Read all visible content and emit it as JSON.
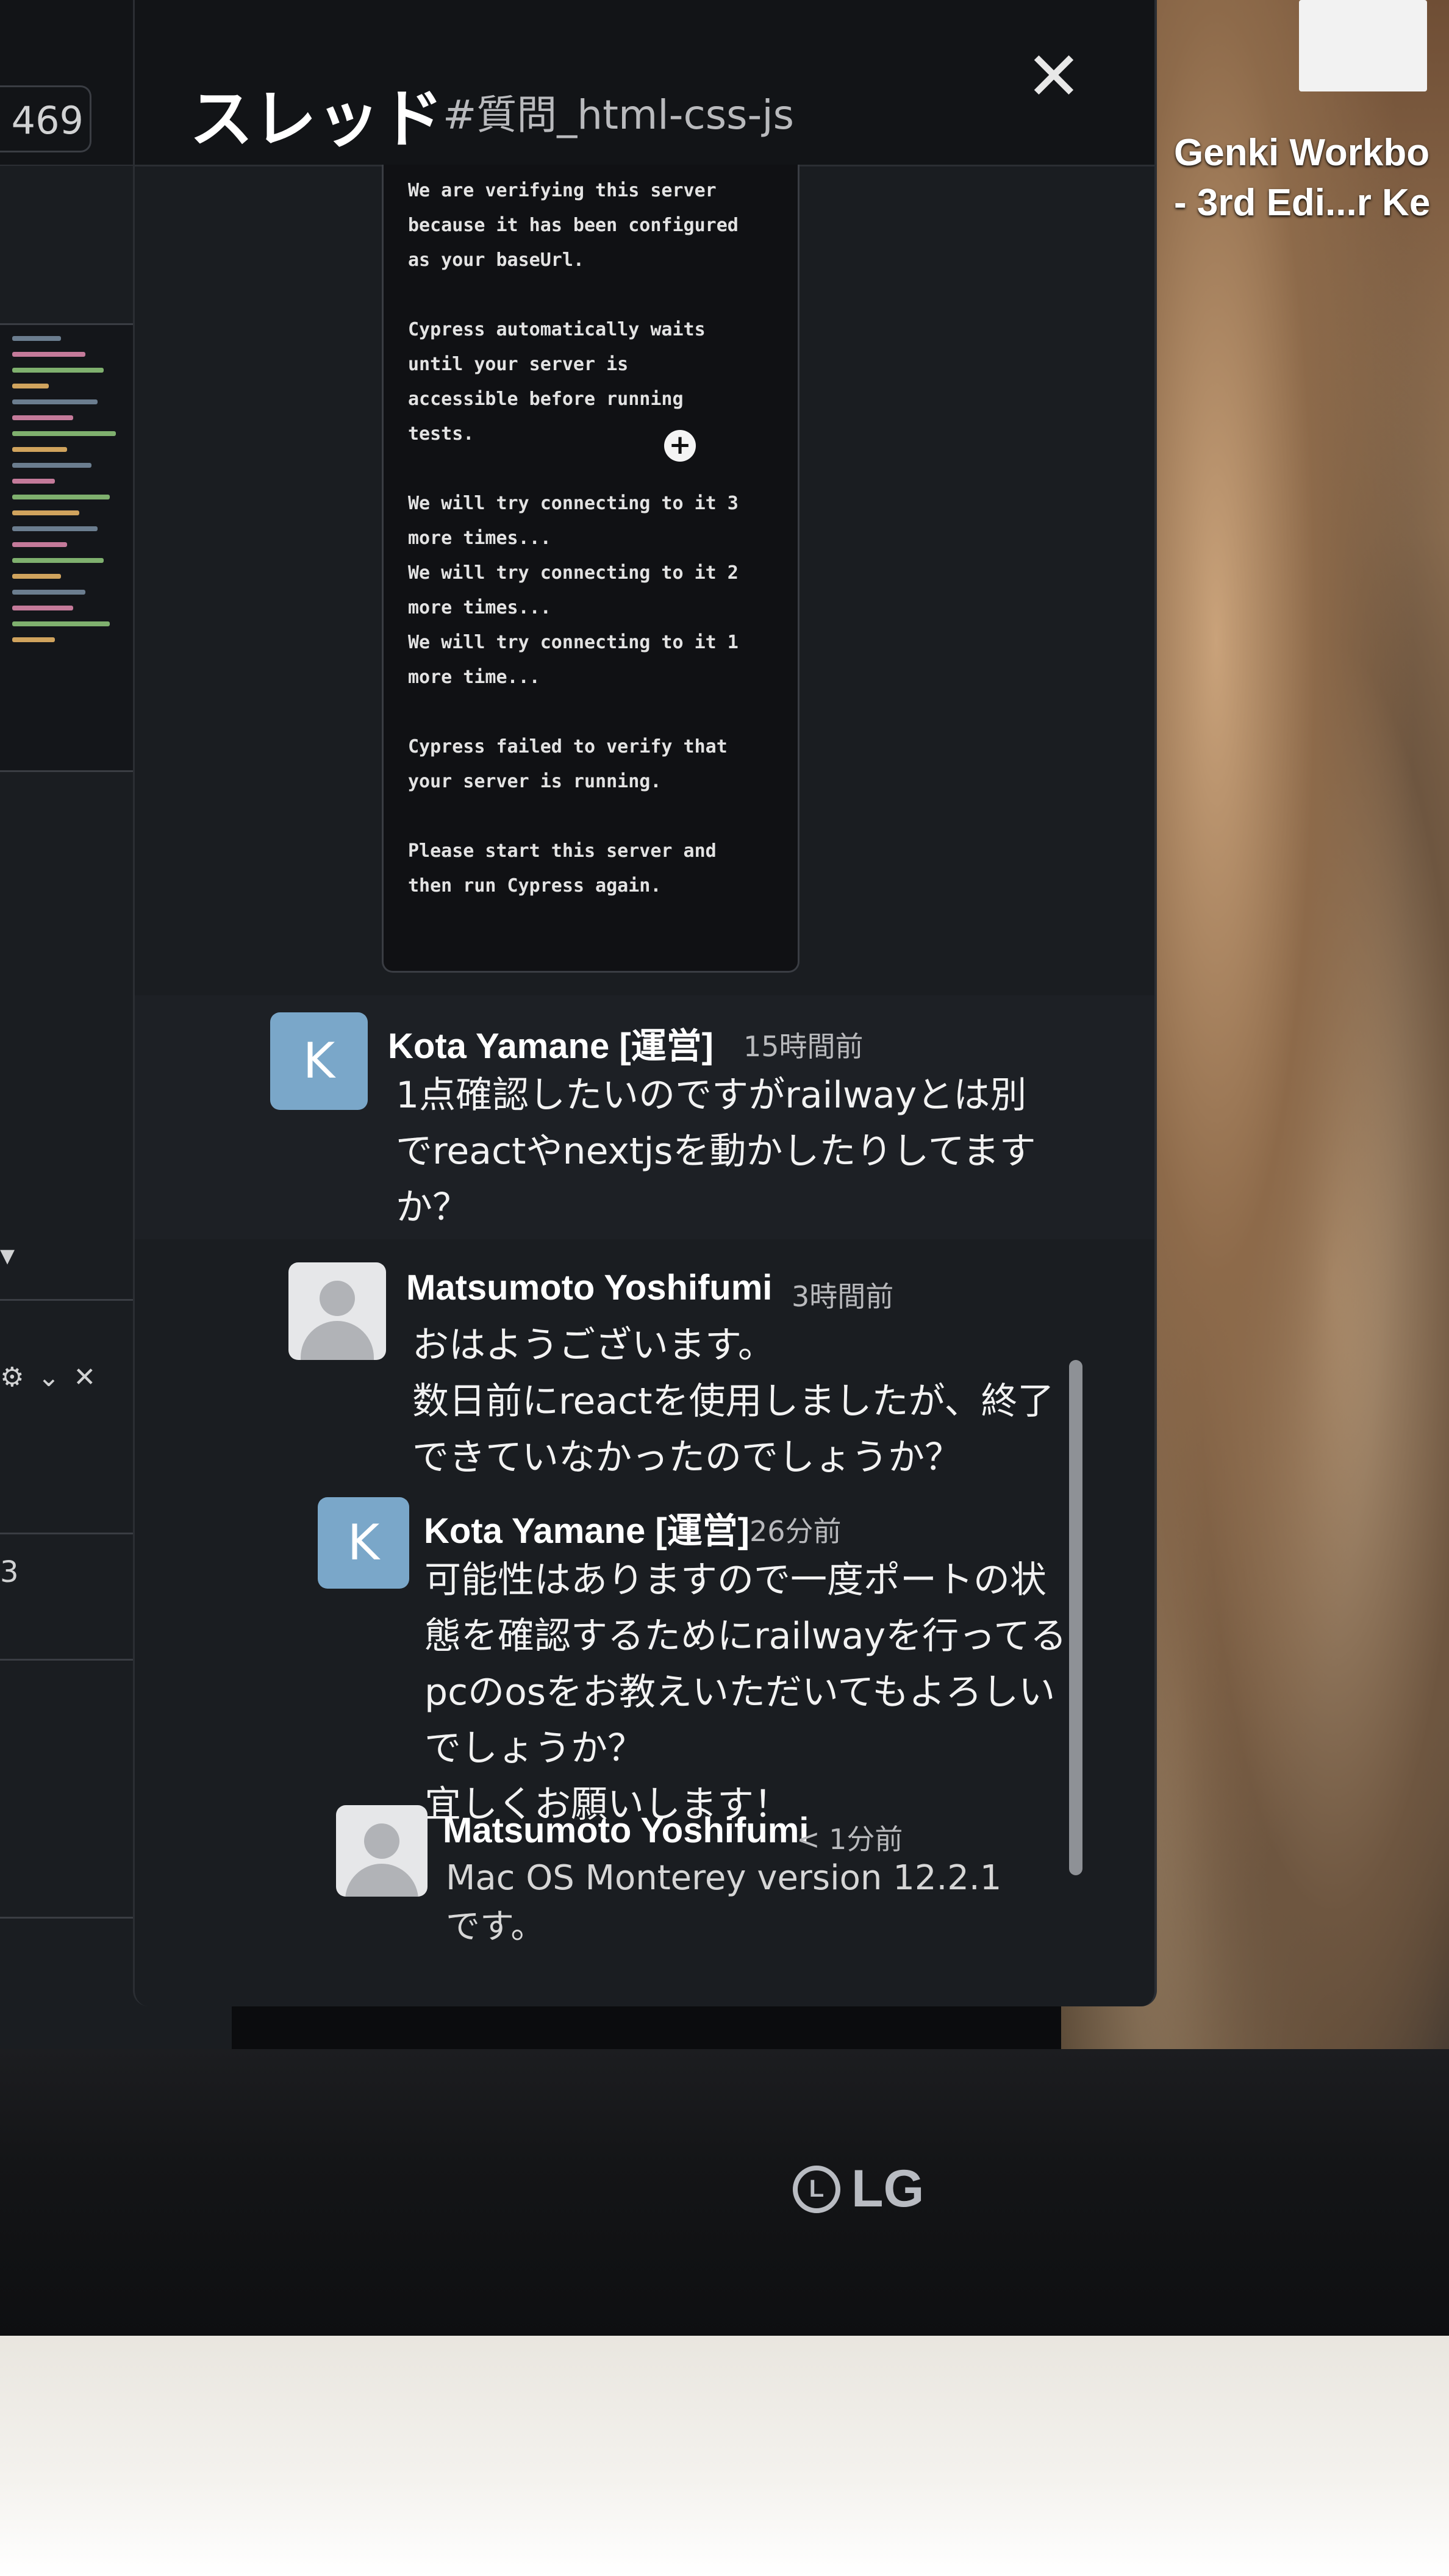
{
  "desktop": {
    "icon_label": "Genki Workbo\n- 3rd Edi...r Ke"
  },
  "monitor": {
    "brand": "LG"
  },
  "sidebar": {
    "count": "469",
    "dropdown_caret": "▾",
    "partial_number": "3"
  },
  "thread": {
    "title": "スレッド",
    "channel": "#質問_html-css-js",
    "close_icon": "✕",
    "attachment_text": "We are verifying this server\nbecause it has been configured\nas your baseUrl.\n\nCypress automatically waits\nuntil your server is\naccessible before running\ntests.\n\nWe will try connecting to it 3\nmore times...\nWe will try connecting to it 2\nmore times...\nWe will try connecting to it 1\nmore time...\n\nCypress failed to verify that\nyour server is running.\n\nPlease start this server and\nthen run Cypress again.",
    "messages": [
      {
        "avatar_letter": "K",
        "author": "Kota Yamane [運営]",
        "time": "15時間前",
        "text": "1点確認したいのですがrailwayとは別\nでreactやnextjsを動かしたりしてます\nか？"
      },
      {
        "avatar_letter": "",
        "author": "Matsumoto Yoshifumi",
        "time": "3時間前",
        "text": "おはようございます。\n数日前にreactを使用しましたが、終了\nできていなかったのでしょうか？"
      },
      {
        "avatar_letter": "K",
        "author": "Kota Yamane [運営]",
        "time": "26分前",
        "text": "可能性はありますので一度ポートの状\n態を確認するためにrailwayを行ってる\npcのosをお教えいただいてもよろしい\nでしょうか？\n宜しくお願いします！"
      },
      {
        "avatar_letter": "",
        "author": "Matsumoto Yoshifumi",
        "time": "< 1分前",
        "text": "Mac OS Monterey version 12.2.1\nです。"
      }
    ]
  },
  "colors": {
    "pane_bg": "#1a1d21",
    "header_bg": "#121417",
    "avatar_k": "#7aa7c9",
    "text": "#f2f2f2",
    "muted": "#b9babd"
  }
}
